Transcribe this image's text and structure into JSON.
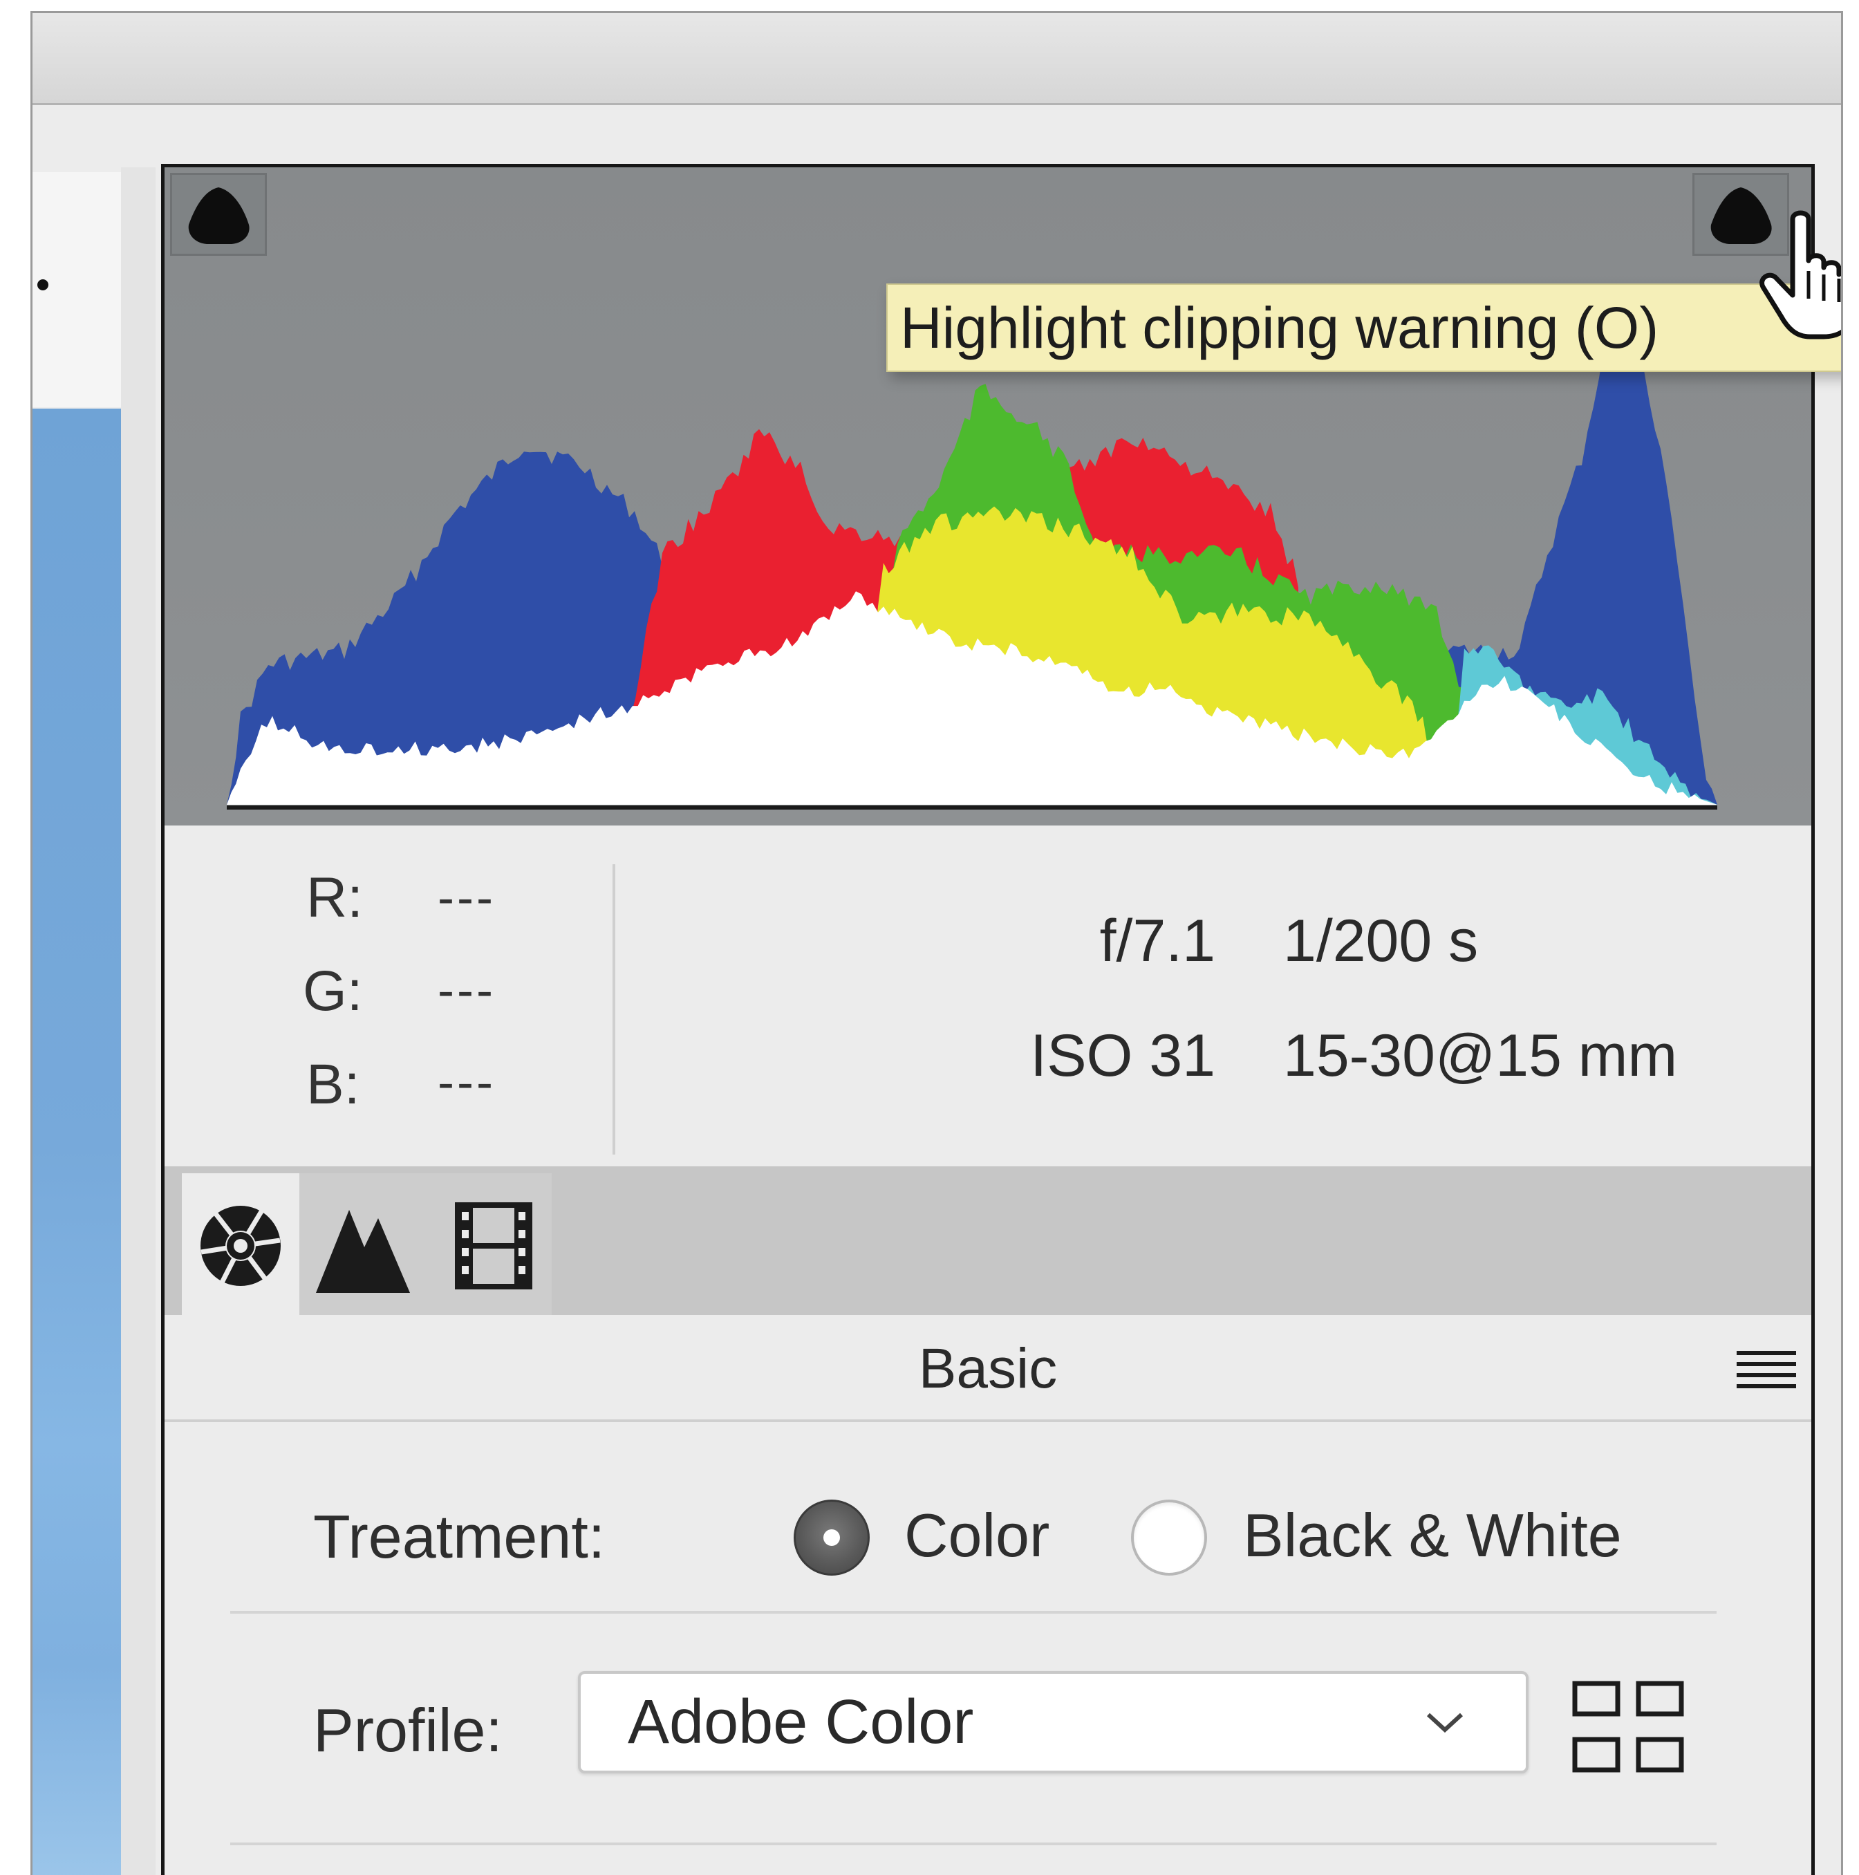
{
  "histogram": {
    "tooltip": "Highlight clipping warning (O)",
    "shadow_clip_icon": "shadow-clip-warning-icon",
    "highlight_clip_icon": "highlight-clip-warning-icon",
    "colors": {
      "background": "#8a8d8f",
      "white": "#ffffff",
      "blue": "#2f4ea8",
      "magenta": "#9b3fae",
      "red": "#ea2030",
      "yellow": "#e8e62e",
      "green": "#4dba2e",
      "cyan": "#5ec9d6"
    }
  },
  "readout": {
    "r_label": "R:",
    "r_value": "---",
    "g_label": "G:",
    "g_value": "---",
    "b_label": "B:",
    "b_value": "---",
    "aperture": "f/7.1",
    "shutter": "1/200 s",
    "iso": "ISO 31",
    "lens": "15-30@15 mm"
  },
  "tabs": [
    {
      "icon": "aperture-icon",
      "selected": true
    },
    {
      "icon": "mountains-icon",
      "selected": false
    },
    {
      "icon": "film-strip-icon",
      "selected": false
    }
  ],
  "section": {
    "title": "Basic",
    "menu_icon": "panel-menu-icon"
  },
  "treatment": {
    "label": "Treatment:",
    "options": [
      "Color",
      "Black & White"
    ],
    "selected": "Color"
  },
  "profile": {
    "label": "Profile:",
    "value": "Adobe Color",
    "browse_icon": "profile-grid-icon"
  }
}
